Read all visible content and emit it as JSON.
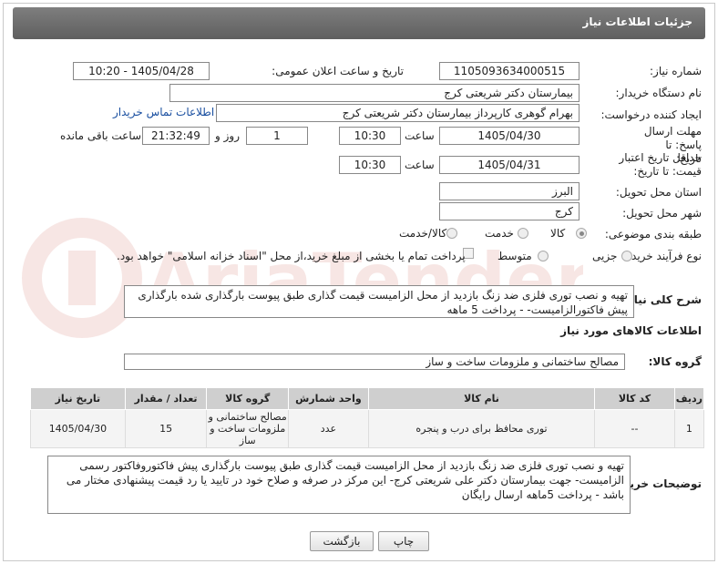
{
  "header": {
    "title": "جزئیات اطلاعات نیاز"
  },
  "labels": {
    "need_number": "شماره نیاز:",
    "announce_datetime": "تاریخ و ساعت اعلان عمومی:",
    "buyer_org": "نام دستگاه خریدار:",
    "requester": "ایجاد کننده درخواست:",
    "reply_deadline": "مهلت ارسال پاسخ: تا تاریخ:",
    "time": "ساعت",
    "day_and": "روز و",
    "remaining": "ساعت باقی مانده",
    "price_validity": "حداقل تاریخ اعتبار قیمت: تا تاریخ:",
    "province": "استان محل تحویل:",
    "city": "شهر محل تحویل:",
    "category": "طبقه بندی موضوعی:",
    "process_type": "نوع فرآیند خرید :",
    "description": "شرح کلی نیاز:",
    "goods_info": "اطلاعات کالاهای مورد نیاز",
    "goods_group": "گروه کالا:",
    "buyer_notes": "توضیحات خریدار:"
  },
  "values": {
    "need_number": "1105093634000515",
    "announce_datetime": "1405/04/28 - 10:20",
    "buyer_org": "بیمارستان دکتر شریعتی کرج",
    "requester": "بهرام گوهری کارپرداز بیمارستان دکتر شریعتی کرج",
    "contact_link": "اطلاعات تماس خریدار",
    "reply_date": "1405/04/30",
    "reply_time": "10:30",
    "reply_days": "1",
    "reply_remaining": "21:32:49",
    "validity_date": "1405/04/31",
    "validity_time": "10:30",
    "province": "البرز",
    "city": "کرج",
    "description": "تهیه و نصب توری فلزی ضد زنگ  بازدید از محل الزامیست قیمت گذاری  طبق پیوست بارگذاری شده بارگذاری پیش فاکتورالزامیست- - پرداخت 5 ماهه",
    "goods_group": "مصالح ساختمانی و ملزومات ساخت و ساز",
    "buyer_notes": "تهیه و نصب توری فلزی ضد زنگ  بازدید از محل الزامیست  قیمت گذاری طبق پیوست بارگذاری پیش فاکتوروفاکتور رسمی الزامیست- جهت بیمارستان دکتر علی شریعتی کرج- این مرکز در صرفه و صلاح خود در تایید یا رد قیمت پیشنهادی مختار می باشد - پرداخت 5ماهه ارسال رایگان"
  },
  "category_options": [
    {
      "label": "کالا",
      "selected": true
    },
    {
      "label": "خدمت",
      "selected": false
    },
    {
      "label": "کالا/خدمت",
      "selected": false
    }
  ],
  "process_options": [
    {
      "label": "جزیی",
      "selected": false
    },
    {
      "label": "متوسط",
      "selected": false
    }
  ],
  "payment_note": "پرداخت تمام یا بخشی از مبلغ خرید،از محل \"اسناد خزانه اسلامی\" خواهد بود.",
  "table": {
    "headers": [
      "ردیف",
      "کد کالا",
      "نام کالا",
      "واحد شمارش",
      "گروه کالا",
      "تعداد / مقدار",
      "تاریخ نیاز"
    ],
    "rows": [
      [
        "1",
        "--",
        "توری محافظ برای درب و پنجره",
        "عدد",
        "مصالح ساختمانی و ملزومات ساخت و ساز",
        "15",
        "1405/04/30"
      ]
    ]
  },
  "buttons": {
    "print": "چاپ",
    "back": "بازگشت"
  },
  "watermark": "AriaTender.net",
  "colors": {
    "header_bg": "#6e6e6e",
    "link": "#1a4fa0",
    "table_header": "#cfcfcf",
    "watermark": "#c0392b"
  }
}
